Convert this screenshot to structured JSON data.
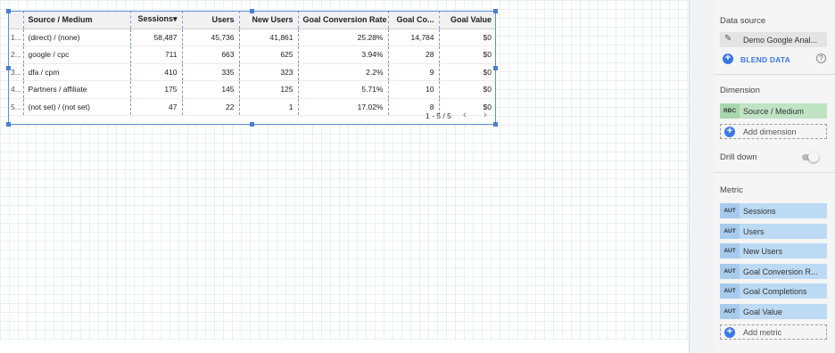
{
  "table": {
    "columns": [
      "",
      "Source / Medium",
      "Sessions",
      "Users",
      "New Users",
      "Goal Conversion Rate",
      "Goal Co...",
      "Goal Value"
    ],
    "sort_indicator": "▾",
    "rows": [
      [
        "1...",
        "(direct) / (none)",
        "58,487",
        "45,736",
        "41,861",
        "25.28%",
        "14,784",
        "$0"
      ],
      [
        "2...",
        "google / cpc",
        "711",
        "663",
        "625",
        "3.94%",
        "28",
        "$0"
      ],
      [
        "3...",
        "dfa / cpm",
        "410",
        "335",
        "323",
        "2.2%",
        "9",
        "$0"
      ],
      [
        "4...",
        "Partners / affiliate",
        "175",
        "145",
        "125",
        "5.71%",
        "10",
        "$0"
      ],
      [
        "5...",
        "(not set) / (not set)",
        "47",
        "22",
        "1",
        "17.02%",
        "8",
        "$0"
      ]
    ],
    "pagination": "1 - 5 / 5",
    "prev_icon": "‹",
    "next_icon": "›"
  },
  "panel": {
    "data_source_title": "Data source",
    "data_source_name": "Demo Google Anal...",
    "blend_label": "BLEND DATA",
    "dimension_title": "Dimension",
    "dimension_chip": {
      "tag": "RBC",
      "label": "Source / Medium"
    },
    "add_dimension": "Add dimension",
    "drill_down": "Drill down",
    "metric_title": "Metric",
    "metrics": [
      {
        "tag": "AUT",
        "label": "Sessions"
      },
      {
        "tag": "AUT",
        "label": "Users"
      },
      {
        "tag": "AUT",
        "label": "New Users"
      },
      {
        "tag": "AUT",
        "label": "Goal Conversion R..."
      },
      {
        "tag": "AUT",
        "label": "Goal Completions"
      },
      {
        "tag": "AUT",
        "label": "Goal Value"
      }
    ],
    "add_metric": "Add metric"
  },
  "colors": {
    "accent": "#3b78e7",
    "dimension_chip": "#bfe3c3",
    "metric_chip": "#bcdaf4"
  }
}
